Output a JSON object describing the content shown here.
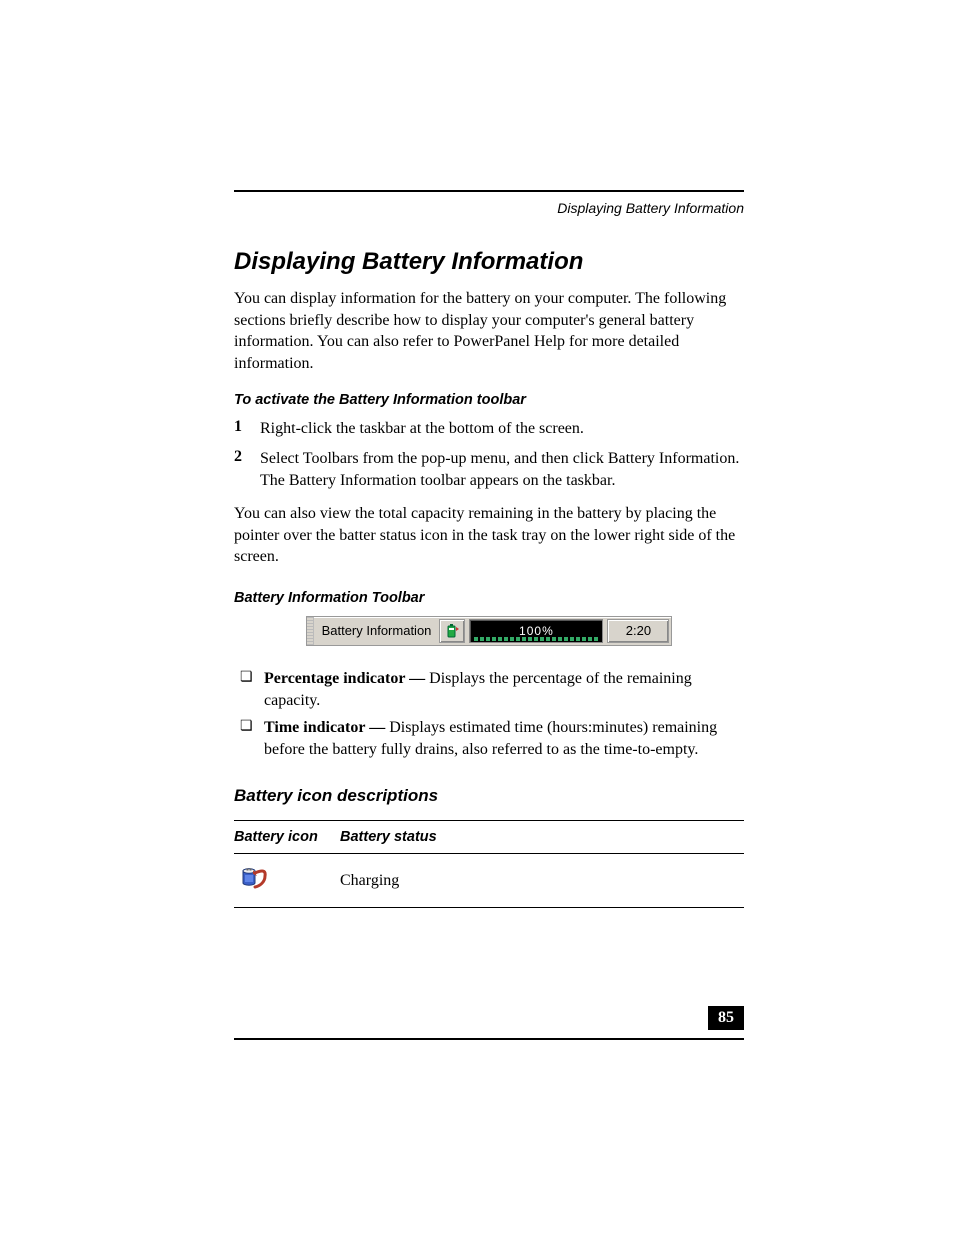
{
  "running_head": "Displaying Battery Information",
  "title": "Displaying Battery Information",
  "intro": "You can display information for the battery on your computer. The following sections briefly describe how to display your computer's general battery information. You can also refer to PowerPanel Help for more detailed information.",
  "activate_heading": "To activate the Battery Information toolbar",
  "steps": [
    {
      "num": "1",
      "text": "Right-click the taskbar at the bottom of the screen."
    },
    {
      "num": "2",
      "text": "Select Toolbars from the pop-up menu, and then click Battery Information. The Battery Information toolbar appears on the taskbar."
    }
  ],
  "tip_paragraph": "You can also view the total capacity remaining in the battery by placing the pointer over the batter status icon in the task tray on the lower right side of the screen.",
  "toolbar_caption": "Battery Information Toolbar",
  "toolbar": {
    "label": "Battery Information",
    "percentage": "100%",
    "time": "2:20"
  },
  "bullets": [
    {
      "term": "Percentage indicator — ",
      "desc": "Displays the percentage of the remaining capacity."
    },
    {
      "term": "Time indicator — ",
      "desc": "Displays estimated time (hours:minutes) remaining before the battery fully drains, also referred to as the time-to-empty."
    }
  ],
  "icon_desc_heading": "Battery icon descriptions",
  "table": {
    "headers": [
      "Battery icon",
      "Battery status"
    ],
    "rows": [
      {
        "status": "Charging"
      }
    ]
  },
  "page_number": "85"
}
